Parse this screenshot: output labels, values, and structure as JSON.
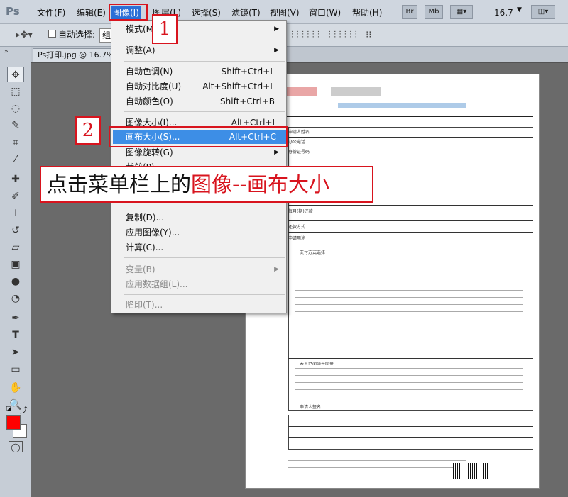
{
  "menubar": {
    "logo": "Ps",
    "items": [
      "文件(F)",
      "编辑(E)",
      "图像(I)",
      "图层(L)",
      "选择(S)",
      "滤镜(T)",
      "视图(V)",
      "窗口(W)",
      "帮助(H)"
    ],
    "br_label": "Br",
    "mb_label": "Mb",
    "zoom": "16.7"
  },
  "optbar": {
    "auto_select_label": "自动选择:",
    "group_value": "组"
  },
  "doc_tab": {
    "title": "Ps打印.jpg @ 16.7%"
  },
  "menu": {
    "items": [
      {
        "label": "模式(M)",
        "submenu": true
      },
      {
        "label": "调整(A)",
        "submenu": true
      },
      {
        "label": "自动色调(N)",
        "shortcut": "Shift+Ctrl+L"
      },
      {
        "label": "自动对比度(U)",
        "shortcut": "Alt+Shift+Ctrl+L"
      },
      {
        "label": "自动颜色(O)",
        "shortcut": "Shift+Ctrl+B"
      },
      {
        "label": "图像大小(I)...",
        "shortcut": "Alt+Ctrl+I"
      },
      {
        "label": "画布大小(S)...",
        "shortcut": "Alt+Ctrl+C"
      },
      {
        "label": "图像旋转(G)",
        "submenu": true
      },
      {
        "label": "裁剪(P)"
      },
      {
        "label": "复制(D)..."
      },
      {
        "label": "应用图像(Y)..."
      },
      {
        "label": "计算(C)..."
      },
      {
        "label": "变量(B)",
        "submenu": true
      },
      {
        "label": "应用数据组(L)..."
      },
      {
        "label": "陷印(T)..."
      }
    ]
  },
  "annotations": {
    "step1": "1",
    "step2": "2",
    "callout_prefix": "点击菜单栏上的",
    "callout_highlight": "图像--画布大小"
  },
  "document": {
    "field_labels": [
      "申请人姓名",
      "办公电话",
      "身份证号码",
      "每月(期)还款",
      "还款方式",
      "申请用途",
      "支付方式选择",
      "本人已阅读并同意",
      "申请人签名"
    ]
  },
  "colors": {
    "accent_red": "#d8141e",
    "menu_highlight": "#3d8ee6",
    "menubar_active": "#2b6fd6",
    "foreground_swatch": "#ff0000",
    "background_swatch": "#ffffff"
  }
}
